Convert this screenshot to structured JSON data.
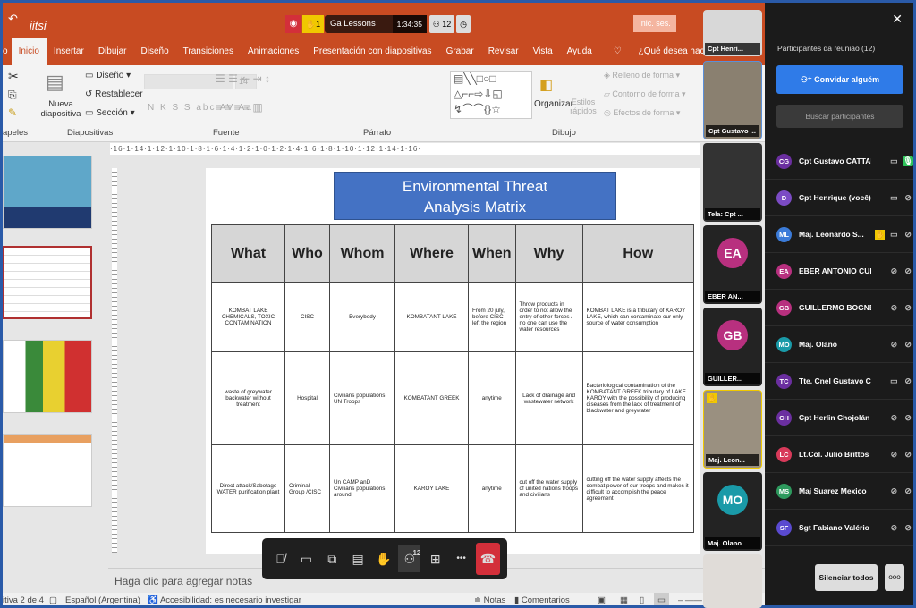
{
  "titlebar": {
    "app_label": "iitsi",
    "recording_icon": "record-icon",
    "raised_hands": "1",
    "meeting_name": "Ga Lessons Learned",
    "timer": "1:34:35",
    "participant_count": "12",
    "sign_in": "Inic. ses."
  },
  "tabs": [
    "o",
    "Inicio",
    "Insertar",
    "Dibujar",
    "Diseño",
    "Transiciones",
    "Animaciones",
    "Presentación con diapositivas",
    "Grabar",
    "Revisar",
    "Vista",
    "Ayuda",
    "¿Qué desea hacer?"
  ],
  "ribbon": {
    "new_slide": "Nueva diapositiva",
    "layout": "Diseño",
    "reset": "Restablecer",
    "section": "Sección",
    "font_size": "14",
    "font_buttons": "N K S S abc AV Aa",
    "arrange": "Organizar",
    "quick_styles": "Estilos rápidos",
    "shape_fill": "Relleno de forma",
    "shape_outline": "Contorno de forma",
    "shape_effects": "Efectos de forma",
    "groups": {
      "clipboard": "apeles",
      "slides": "Diapositivas",
      "font": "Fuente",
      "paragraph": "Párrafo",
      "drawing": "Dibujo"
    }
  },
  "ruler": "·16·1·14·1·12·1·10·1·8·1·6·1·4·1·2·1·0·1·2·1·4·1·6·1·8·1·10·1·12·1·14·1·16·",
  "slide": {
    "title_line1": "Environmental Threat",
    "title_line2": "Analysis Matrix",
    "headers": [
      "What",
      "Who",
      "Whom",
      "Where",
      "When",
      "Why",
      "How"
    ],
    "rows": [
      [
        "KOMBAT LAKE CHEMICALS, TOXIC CONTAMINATION",
        "CISC",
        "Everybody",
        "KOMBATANT LAKE",
        "From 20 july, before CISC left the region",
        "Throw products in order to not allow the entry of other forces / no one can use the water resources",
        "KOMBAT LAKE is a tributary of KAROY LAKE, which can contaminate our only source of water consumption"
      ],
      [
        "waste of greywater backwater without treatment",
        "Hospital",
        "Civilians populations UN Troops",
        "KOMBATANT GREEK",
        "anytime",
        "Lack of drainage and wastewater network",
        "Bacteriological contamination of the KOMBATANT GREEK tributary of LAKE KAROY with the possibility of producing diseases from the lack of treatment of blackwater and greywater"
      ],
      [
        "Direct attack/Sabotage WATER purification plant",
        "Criminal Group /CISC",
        "Un CAMP anD Civilians populations around",
        "KAROY LAKE",
        "anytime",
        "cut off the water supply of united nations troops and civilians",
        "cutting off the water supply affects the combat power of our troops and makes it difficult to accomplish the peace agreement"
      ]
    ]
  },
  "notes_placeholder": "Haga clic para agregar notas",
  "status": {
    "slide": "itiva 2 de 4",
    "language": "Español (Argentina)",
    "accessibility": "Accesibilidad: es necesario investigar",
    "notes": "Notas",
    "comments": "Comentarios"
  },
  "meeting_toolbar": {
    "participants_badge": "12"
  },
  "video_tiles": [
    {
      "name": "Cpt Henri...",
      "type": "video"
    },
    {
      "name": "Cpt Gustavo ...",
      "type": "video"
    },
    {
      "name": "Tela: Cpt ...",
      "type": "screen"
    },
    {
      "name": "EBER AN...",
      "initials": "EA",
      "color": "#b8307f"
    },
    {
      "name": "GUILLER...",
      "initials": "GB",
      "color": "#b8307f"
    },
    {
      "name": "Maj. Leon...",
      "type": "video"
    },
    {
      "name": "Maj. Olano",
      "initials": "MO",
      "color": "#1a9aa8"
    }
  ],
  "panel": {
    "title": "Participantes da reunião (12)",
    "invite": "Convidar alguém",
    "search_placeholder": "Buscar participantes",
    "mute_all": "Silenciar todos",
    "more": "ooo",
    "participants": [
      {
        "initials": "CG",
        "name": "Cpt Gustavo CATTAN...",
        "color": "#6b2fa0",
        "cam": "on",
        "mic": "speaking"
      },
      {
        "initials": "D",
        "name": "Cpt Henrique (você)",
        "color": "#7b4bc4",
        "cam": "on",
        "mic": "muted"
      },
      {
        "initials": "ML",
        "name": "Maj. Leonardo S...",
        "color": "#3b7bd8",
        "cam": "on",
        "mic": "muted",
        "hand": true
      },
      {
        "initials": "EA",
        "name": "EBER ANTONIO CUE...",
        "color": "#b8307f",
        "cam": "off",
        "mic": "muted"
      },
      {
        "initials": "GB",
        "name": "GUILLERMO BOGNER",
        "color": "#b8307f",
        "cam": "off",
        "mic": "muted"
      },
      {
        "initials": "MO",
        "name": "Maj. Olano",
        "color": "#1a9aa8",
        "cam": "off",
        "mic": "muted"
      },
      {
        "initials": "TC",
        "name": "Tte. Cnel Gustavo Cabo",
        "color": "#6b2fa0",
        "cam": "on",
        "mic": "muted"
      },
      {
        "initials": "CH",
        "name": "Cpt Herlin Chojolán",
        "color": "#6b2fa0",
        "cam": "off",
        "mic": "muted"
      },
      {
        "initials": "LC",
        "name": "Lt.Col. Julio Brittos",
        "color": "#d83a5a",
        "cam": "off",
        "mic": "muted"
      },
      {
        "initials": "MS",
        "name": "Maj Suarez Mexico",
        "color": "#2e9a5e",
        "cam": "off",
        "mic": "muted"
      },
      {
        "initials": "SF",
        "name": "Sgt Fabiano Valério",
        "color": "#5a4ad0",
        "cam": "off",
        "mic": "muted"
      }
    ]
  },
  "colors": {
    "ppt_orange": "#c84b22",
    "teams_blue": "#2f7be8",
    "end_call": "#d32f3a",
    "slide_title_bg": "#4472c4"
  }
}
